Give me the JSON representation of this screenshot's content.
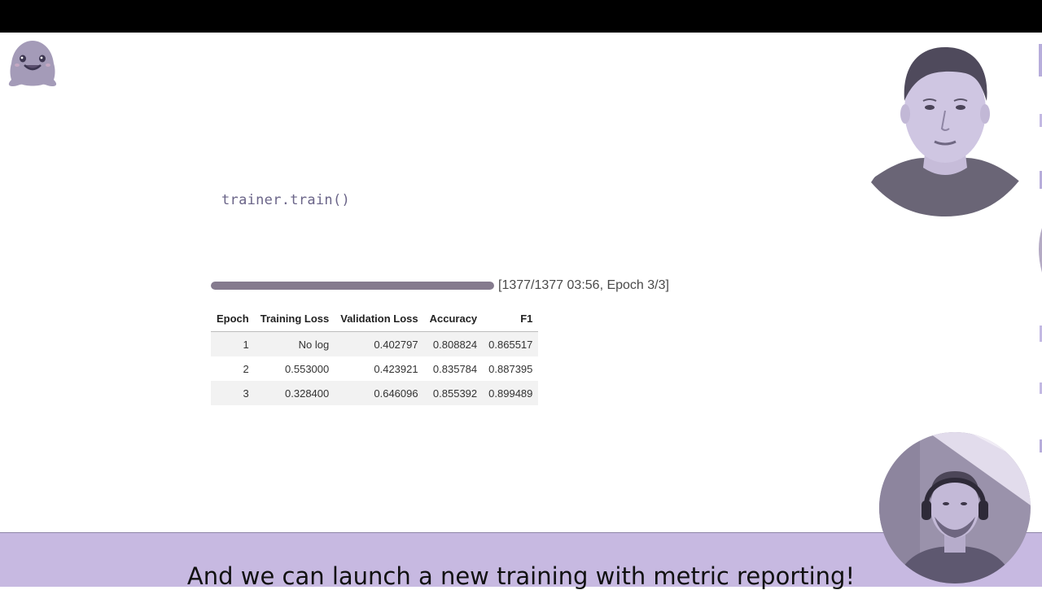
{
  "code": {
    "line": "trainer.train()"
  },
  "progress": {
    "fraction": 1.0,
    "status": "[1377/1377 03:56, Epoch 3/3]"
  },
  "metrics_table": {
    "headers": [
      "Epoch",
      "Training Loss",
      "Validation Loss",
      "Accuracy",
      "F1"
    ],
    "rows": [
      [
        "1",
        "No log",
        "0.402797",
        "0.808824",
        "0.865517"
      ],
      [
        "2",
        "0.553000",
        "0.423921",
        "0.835784",
        "0.887395"
      ],
      [
        "3",
        "0.328400",
        "0.646096",
        "0.855392",
        "0.899489"
      ]
    ]
  },
  "caption": {
    "text": "And we can launch a new training with metric reporting!"
  },
  "colors": {
    "caption_bg": "#c7b9e1",
    "top_bar": "#000000",
    "progress_fill": "#857b8e"
  }
}
